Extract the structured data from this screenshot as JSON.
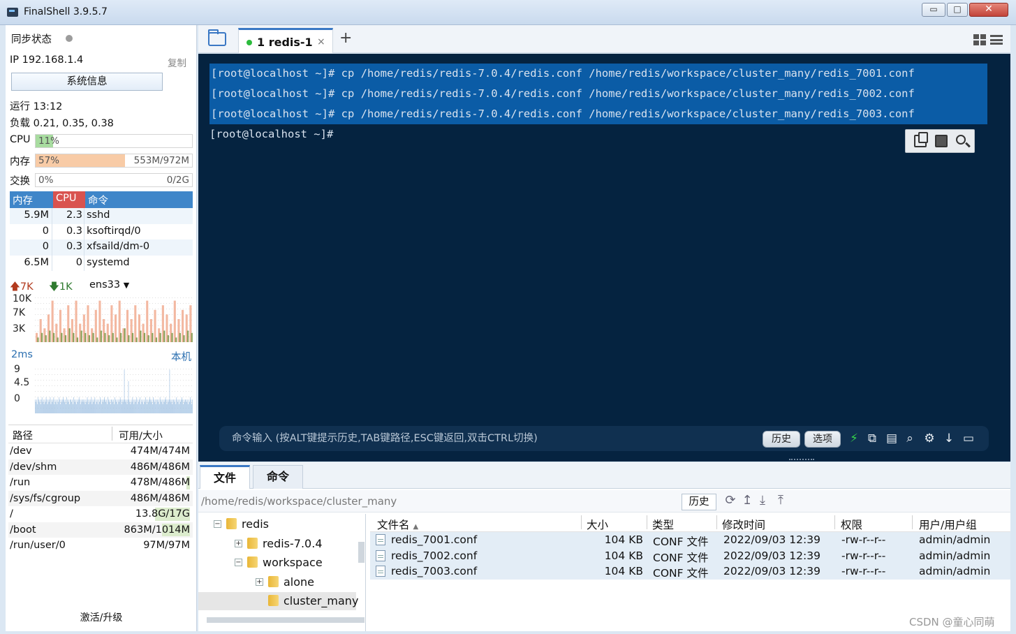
{
  "window": {
    "title": "FinalShell 3.9.5.7",
    "controls": {
      "min": "▭",
      "max": "□",
      "close": "✕"
    }
  },
  "sidebar": {
    "sync_label": "同步状态",
    "ip": "IP 192.168.1.4",
    "copy": "复制",
    "sysinfo_button": "系统信息",
    "uptime": "运行 13:12",
    "load": "负载 0.21, 0.35, 0.38",
    "cpu": {
      "label": "CPU",
      "pct": "11%",
      "fraction": 0.11
    },
    "mem": {
      "label": "内存",
      "pct": "57%",
      "detail": "553M/972M",
      "fraction": 0.57
    },
    "swap": {
      "label": "交换",
      "pct": "0%",
      "detail": "0/2G",
      "fraction": 0.0
    },
    "process_headers": {
      "mem": "内存",
      "cpu": "CPU",
      "cmd": "命令"
    },
    "processes": [
      {
        "mem": "5.9M",
        "cpu": "2.3",
        "cmd": "sshd"
      },
      {
        "mem": "0",
        "cpu": "0.3",
        "cmd": "ksoftirqd/0"
      },
      {
        "mem": "0",
        "cpu": "0.3",
        "cmd": "xfsaild/dm-0"
      },
      {
        "mem": "6.5M",
        "cpu": "0",
        "cmd": "systemd"
      }
    ],
    "net": {
      "up": "7K",
      "down": "1K",
      "iface": "ens33",
      "y_ticks": [
        "10K",
        "7K",
        "3K"
      ],
      "upload_series": [
        0.2,
        0.5,
        0.3,
        0.6,
        0.9,
        0.4,
        0.7,
        0.3,
        0.8,
        0.5,
        0.9,
        0.4,
        0.6,
        0.8,
        0.3,
        0.7,
        0.9,
        0.5,
        0.4,
        0.8,
        0.6,
        0.9,
        0.3,
        0.7,
        0.5,
        0.8,
        0.6,
        0.4,
        0.9,
        0.5,
        0.7,
        0.3,
        0.8,
        0.6,
        0.4,
        0.9,
        0.5,
        0.7,
        0.6,
        0.8
      ],
      "download_series": [
        0.1,
        0.2,
        0.15,
        0.25,
        0.2,
        0.1,
        0.2,
        0.15,
        0.3,
        0.2,
        0.1,
        0.25,
        0.2,
        0.15,
        0.2,
        0.1,
        0.25,
        0.2,
        0.15,
        0.2,
        0.1,
        0.2,
        0.3,
        0.15,
        0.2,
        0.1,
        0.25,
        0.2,
        0.15,
        0.2,
        0.1,
        0.2,
        0.25,
        0.15,
        0.2,
        0.1,
        0.2,
        0.15,
        0.25,
        0.2
      ]
    },
    "latency": {
      "label": "2ms",
      "host": "本机",
      "y_ticks": [
        "9",
        "4.5",
        "0"
      ],
      "series": [
        0.3,
        0.25,
        0.3,
        0.2,
        0.35,
        0.3,
        0.25,
        0.3,
        0.2,
        0.3,
        0.35,
        0.25,
        0.3,
        0.2,
        0.3,
        0.25,
        0.35,
        0.3,
        0.2,
        0.3,
        0.25,
        0.3,
        0.35,
        0.2,
        0.3,
        0.25,
        0.3,
        0.35,
        0.2,
        0.3,
        0.25,
        0.3,
        0.2,
        0.3,
        0.25,
        0.35,
        0.3,
        0.2,
        0.3,
        0.25,
        0.3,
        0.35,
        0.3,
        0.25,
        0.3,
        0.2,
        0.35,
        0.3,
        0.25,
        0.3,
        0.2,
        0.3,
        0.3,
        0.25,
        0.3,
        0.2,
        0.35,
        0.3,
        0.25,
        0.3,
        0.2,
        0.3,
        0.25,
        0.3,
        0.35,
        0.3,
        0.2,
        0.3,
        0.25,
        0.3,
        0.3,
        0.25,
        0.3,
        0.2,
        0.3,
        0.25,
        0.35,
        0.3,
        0.2,
        0.3,
        0.25,
        0.3,
        0.35,
        0.2,
        0.3,
        0.25,
        0.3,
        0.35,
        0.2,
        0.3,
        0.25,
        0.3,
        0.2,
        0.3,
        0.25,
        0.35,
        0.3,
        0.2,
        0.3,
        0.25,
        0.3,
        0.35,
        0.3,
        0.25,
        0.3,
        0.2,
        0.35,
        0.3,
        0.25,
        0.3,
        0.2,
        0.3,
        0.3,
        0.25,
        0.3,
        0.2,
        0.35,
        0.3,
        0.25,
        0.3,
        0.2,
        0.3,
        0.25,
        0.3,
        0.35,
        0.3,
        0.2,
        0.3,
        0.25,
        0.3,
        0.95,
        0.3,
        0.25,
        0.3,
        0.2,
        0.3,
        0.7,
        0.3,
        0.25,
        0.2,
        0.3,
        0.25,
        0.35,
        0.3,
        0.2,
        0.3,
        0.25,
        0.3,
        0.35,
        0.2,
        0.3,
        0.25,
        0.3,
        0.35,
        0.2,
        0.3,
        0.25,
        0.3,
        0.2,
        0.3,
        0.25,
        0.35,
        0.3,
        0.2,
        0.3,
        0.25,
        0.3,
        0.35,
        0.3,
        0.25,
        0.3,
        0.2,
        0.35,
        0.3,
        0.25,
        0.3,
        0.2,
        0.3,
        0.3,
        0.25,
        0.3,
        0.2,
        0.35,
        0.3,
        0.25,
        0.3,
        0.2,
        0.3,
        0.25,
        0.3,
        0.35,
        0.3,
        0.2,
        0.3,
        0.25,
        0.3,
        0.95,
        0.3,
        0.25,
        0.3,
        0.2,
        0.3,
        0.3,
        0.25,
        0.3,
        0.2,
        0.35,
        0.3,
        0.25,
        0.3,
        0.2,
        0.3,
        0.25,
        0.3,
        0.35,
        0.3,
        0.2,
        0.3,
        0.25,
        0.3,
        0.3,
        0.25,
        0.3,
        0.2,
        0.3,
        0.25,
        0.35,
        0.3,
        0.2,
        0.3
      ]
    },
    "disk_headers": {
      "path": "路径",
      "avail": "可用/大小"
    },
    "disks": [
      {
        "path": "/dev",
        "size": "474M/474M",
        "used": 0.0
      },
      {
        "path": "/dev/shm",
        "size": "486M/486M",
        "used": 0.0
      },
      {
        "path": "/run",
        "size": "478M/486M",
        "used": 0.02
      },
      {
        "path": "/sys/fs/cgroup",
        "size": "486M/486M",
        "used": 0.0
      },
      {
        "path": "/",
        "size": "13.8G/17G",
        "used": 0.19
      },
      {
        "path": "/boot",
        "size": "863M/1014M",
        "used": 0.15
      },
      {
        "path": "/run/user/0",
        "size": "97M/97M",
        "used": 0.0
      }
    ],
    "activate": "激活/升级"
  },
  "tabs": {
    "session_tab": "1 redis-1",
    "close": "×",
    "add": "+"
  },
  "terminal": {
    "lines": [
      {
        "text": "[root@localhost ~]# cp /home/redis/redis-7.0.4/redis.conf /home/redis/workspace/cluster_many/redis_7001.conf",
        "selected": true
      },
      {
        "text": "[root@localhost ~]# cp /home/redis/redis-7.0.4/redis.conf /home/redis/workspace/cluster_many/redis_7002.conf",
        "selected": true
      },
      {
        "text": "[root@localhost ~]# cp /home/redis/redis-7.0.4/redis.conf /home/redis/workspace/cluster_many/redis_7003.conf",
        "selected": true
      },
      {
        "text": "[root@localhost ~]#",
        "selected": false
      }
    ],
    "cmd_placeholder": "命令输入 (按ALT键提示历史,TAB键路径,ESC键返回,双击CTRL切换)",
    "history_button": "历史",
    "options_button": "选项",
    "colors": {
      "background": "#052340",
      "selection": "#0b5ca6"
    }
  },
  "files": {
    "tabs": [
      "文件",
      "命令"
    ],
    "path": "/home/redis/workspace/cluster_many",
    "history_button": "历史",
    "tree": [
      {
        "label": "redis",
        "expander": "−",
        "level": 0
      },
      {
        "label": "redis-7.0.4",
        "expander": "+",
        "level": 1
      },
      {
        "label": "workspace",
        "expander": "−",
        "level": 1
      },
      {
        "label": "alone",
        "expander": "+",
        "level": 2
      },
      {
        "label": "cluster_many",
        "expander": "",
        "level": 2
      }
    ],
    "columns": {
      "name": "文件名",
      "size": "大小",
      "type": "类型",
      "mtime": "修改时间",
      "perm": "权限",
      "owner": "用户/用户组"
    },
    "rows": [
      {
        "name": "redis_7001.conf",
        "size": "104 KB",
        "type": "CONF 文件",
        "mtime": "2022/09/03 12:39",
        "perm": "-rw-r--r--",
        "owner": "admin/admin"
      },
      {
        "name": "redis_7002.conf",
        "size": "104 KB",
        "type": "CONF 文件",
        "mtime": "2022/09/03 12:39",
        "perm": "-rw-r--r--",
        "owner": "admin/admin"
      },
      {
        "name": "redis_7003.conf",
        "size": "104 KB",
        "type": "CONF 文件",
        "mtime": "2022/09/03 12:39",
        "perm": "-rw-r--r--",
        "owner": "admin/admin"
      }
    ]
  },
  "watermark": "CSDN @童心同萌"
}
